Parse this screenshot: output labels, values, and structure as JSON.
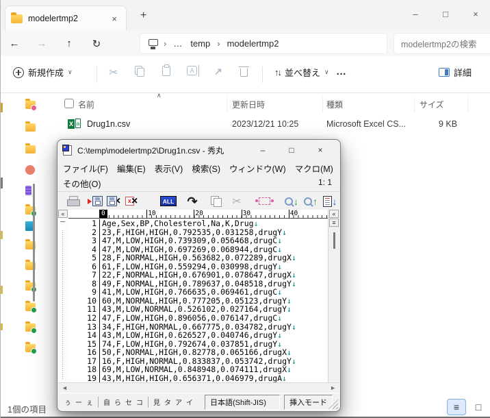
{
  "icons": {
    "minimize": "–",
    "maximize": "□",
    "close": "×",
    "new_tab": "+",
    "back": "←",
    "forward": "→",
    "up": "↑",
    "refresh": "↻",
    "chevron_right": "›",
    "ellipsis": "…",
    "chevron_down": "∨",
    "sort_asc": "∧",
    "sort_arrows": "↑↓",
    "more": "…",
    "guillemet": "«",
    "list": "≡",
    "square": "□",
    "scroll_left": "◄",
    "scroll_right": "►",
    "newline_mark": "↓",
    "scissors": "✂",
    "redo": "↷",
    "share": "↗",
    "rename_letter": "A",
    "down_arrow": "↓",
    "up_arrow": "↑",
    "excel_x": "X",
    "excel_a": "a"
  },
  "explorer": {
    "tab_title": "modelertmp2",
    "search_placeholder": "modelertmp2の検索",
    "breadcrumb": {
      "item1": "temp",
      "item2": "modelertmp2"
    },
    "commandbar": {
      "new_label": "新規作成",
      "sort_label": "並べ替え",
      "details_label": "詳細"
    },
    "columns": {
      "name": "名前",
      "date": "更新日時",
      "type": "種類",
      "size": "サイズ"
    },
    "file": {
      "name": "Drug1n.csv",
      "date": "2023/12/21 10:25",
      "type": "Microsoft Excel CS...",
      "size": "9 KB"
    },
    "status_items": "1個の項目",
    "sidebar_icons": [
      "folder-dot-pink",
      "folder",
      "folder",
      "circle-red",
      "purple",
      "folder-check",
      "drive-blue",
      "folder",
      "folder",
      "folder-check",
      "folder-check",
      "folder-check",
      "folder-check"
    ]
  },
  "editor": {
    "window_title": "C:\\temp\\modelertmp2\\Drug1n.csv  - 秀丸",
    "menu_row1": [
      "ファイル(F)",
      "編集(E)",
      "表示(V)",
      "検索(S)",
      "ウィンドウ(W)",
      "マクロ(M)"
    ],
    "menu_row2": [
      "その他(O)"
    ],
    "cursor_position": "1: 1",
    "toolbar_all_label": "ALL",
    "toolbar_icons": [
      "print",
      "open",
      "save-close",
      "close-x",
      "select-all",
      "redo",
      "copy",
      "cut",
      "paste-box",
      "find-next",
      "find-prev",
      "grep"
    ],
    "ruler_numbers": [
      0,
      10,
      20,
      30,
      40
    ],
    "lines": [
      "Age,Sex,BP,Cholesterol,Na,K,Drug",
      "23,F,HIGH,HIGH,0.792535,0.031258,drugY",
      "47,M,LOW,HIGH,0.739309,0.056468,drugC",
      "47,M,LOW,HIGH,0.697269,0.068944,drugC",
      "28,F,NORMAL,HIGH,0.563682,0.072289,drugX",
      "61,F,LOW,HIGH,0.559294,0.030998,drugY",
      "22,F,NORMAL,HIGH,0.676901,0.078647,drugX",
      "49,F,NORMAL,HIGH,0.789637,0.048518,drugY",
      "41,M,LOW,HIGH,0.766635,0.069461,drugC",
      "60,M,NORMAL,HIGH,0.777205,0.05123,drugY",
      "43,M,LOW,NORMAL,0.526102,0.027164,drugY",
      "47,F,LOW,HIGH,0.896056,0.076147,drugC",
      "34,F,HIGH,NORMAL,0.667775,0.034782,drugY",
      "43,M,LOW,HIGH,0.626527,0.040746,drugY",
      "74,F,LOW,HIGH,0.792674,0.037851,drugY",
      "50,F,NORMAL,HIGH,0.82778,0.065166,drugX",
      "16,F,HIGH,NORMAL,0.833837,0.053742,drugY",
      "69,M,LOW,NORMAL,0.848948,0.074111,drugX",
      "43,M,HIGH,HIGH,0.656371,0.046979,drugA"
    ],
    "statusbar": {
      "glyph_groups": [
        [
          "ぅ",
          "ー",
          "ぇ"
        ],
        [
          "自",
          "ら",
          "セ",
          "コ"
        ],
        [
          "見",
          "タ",
          "ア",
          "イ"
        ]
      ],
      "encoding": "日本語(Shift-JIS)",
      "input_mode": "挿入モード"
    }
  },
  "colors": {
    "accent_blue": "#0067c0",
    "newline_teal": "#008f8f",
    "excel_green": "#107c41",
    "folder_yellow": "#f5b733"
  }
}
